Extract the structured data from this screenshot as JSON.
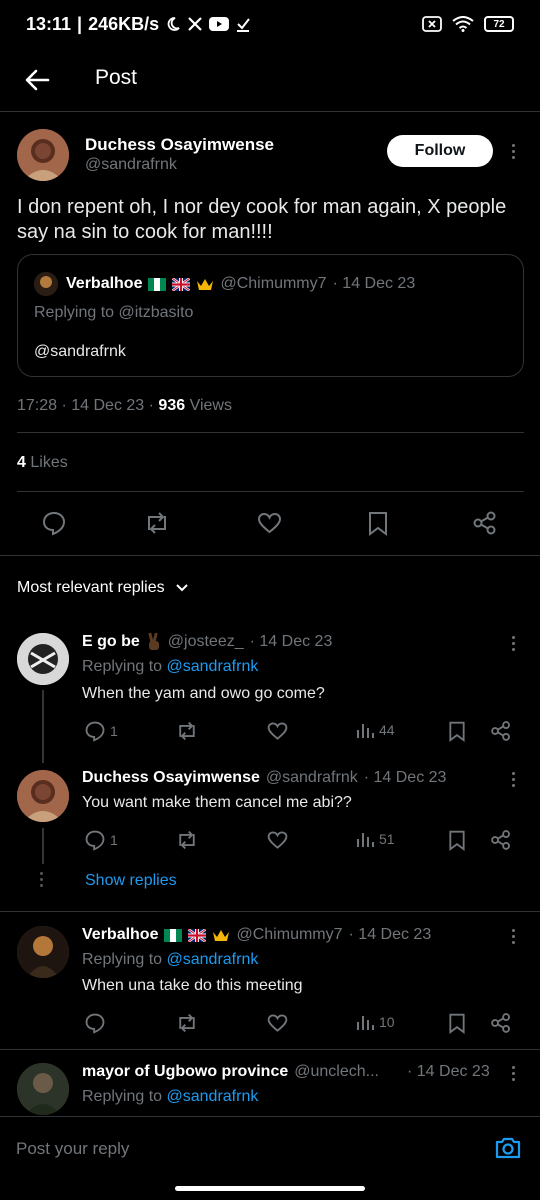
{
  "status_bar": {
    "time": "13:11",
    "speed": "246KB/s",
    "battery": "72"
  },
  "header": {
    "title": "Post"
  },
  "post": {
    "author_name": "Duchess Osayimwense",
    "author_handle": "@sandrafrnk",
    "follow_label": "Follow",
    "text": "I don repent oh, I nor dey cook for man again, X people say na sin to cook for man!!!!",
    "quote": {
      "name": "Verbalhoe",
      "handle": "@Chimummy7",
      "date": "· 14 Dec 23",
      "replying": "Replying to @itzbasito",
      "body": "@sandrafrnk"
    },
    "time": "17:28 · 14 Dec 23 ·",
    "views_count": "936",
    "views_label": "Views",
    "likes_count": "4",
    "likes_label": "Likes"
  },
  "replies_filter": "Most relevant replies",
  "replies": [
    {
      "name": "E go be",
      "handle": "@josteez_",
      "date": "· 14 Dec 23",
      "replying_prefix": "Replying to",
      "replying_to": "@sandrafrnk",
      "text": "When the yam and owo go come?",
      "comments": "1",
      "views": "44"
    },
    {
      "name": "Duchess Osayimwense",
      "handle": "@sandrafrnk",
      "date": "· 14 Dec 23",
      "text": "You want make them cancel me abi??",
      "comments": "1",
      "views": "51",
      "show_replies": "Show replies"
    },
    {
      "name": "Verbalhoe",
      "handle": "@Chimummy7",
      "date": "· 14 Dec 23",
      "replying_prefix": "Replying to",
      "replying_to": "@sandrafrnk",
      "text": "When una take do this meeting",
      "views": "10"
    },
    {
      "name": "mayor of Ugbowo province",
      "handle": "@unclech...",
      "date": "· 14 Dec 23",
      "replying_prefix": "Replying to",
      "replying_to": "@sandrafrnk"
    }
  ],
  "compose": {
    "placeholder": "Post your reply"
  },
  "colors": {
    "accent": "#1d9bf0",
    "muted": "#71767b",
    "border": "#2f3336"
  }
}
